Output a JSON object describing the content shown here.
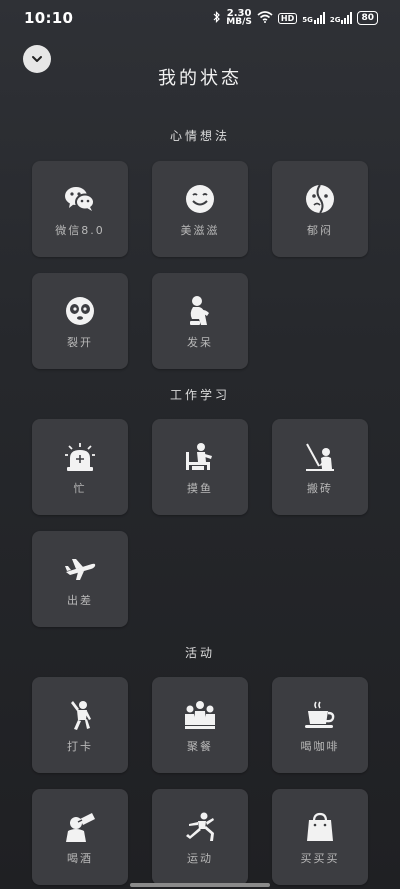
{
  "status": {
    "time": "10:10",
    "speed_value": "2.30",
    "speed_unit": "MB/S",
    "hd_badge": "HD",
    "net1": "5G",
    "net2": "2G",
    "battery": "80"
  },
  "title": "我的状态",
  "sections": {
    "mood": {
      "heading": "心情想法",
      "items": [
        {
          "label": "微信8.0",
          "icon": "wechat-icon"
        },
        {
          "label": "美滋滋",
          "icon": "smile-icon"
        },
        {
          "label": "郁闷",
          "icon": "depressed-icon"
        },
        {
          "label": "裂开",
          "icon": "panda-face-icon"
        },
        {
          "label": "发呆",
          "icon": "sitting-person-icon"
        }
      ]
    },
    "work": {
      "heading": "工作学习",
      "items": [
        {
          "label": "忙",
          "icon": "siren-icon"
        },
        {
          "label": "摸鱼",
          "icon": "desk-person-icon"
        },
        {
          "label": "搬砖",
          "icon": "worker-icon"
        },
        {
          "label": "出差",
          "icon": "airplane-icon"
        }
      ]
    },
    "activity": {
      "heading": "活动",
      "items": [
        {
          "label": "打卡",
          "icon": "checkin-person-icon"
        },
        {
          "label": "聚餐",
          "icon": "group-people-icon"
        },
        {
          "label": "喝咖啡",
          "icon": "coffee-cup-icon"
        },
        {
          "label": "喝酒",
          "icon": "drinking-icon"
        },
        {
          "label": "运动",
          "icon": "running-icon"
        },
        {
          "label": "买买买",
          "icon": "shopping-bag-icon"
        }
      ]
    }
  },
  "colors": {
    "background": "#2a2c30",
    "tile": "#3c3d41",
    "icon": "#f2f2f2",
    "label": "#b8b8b8"
  }
}
